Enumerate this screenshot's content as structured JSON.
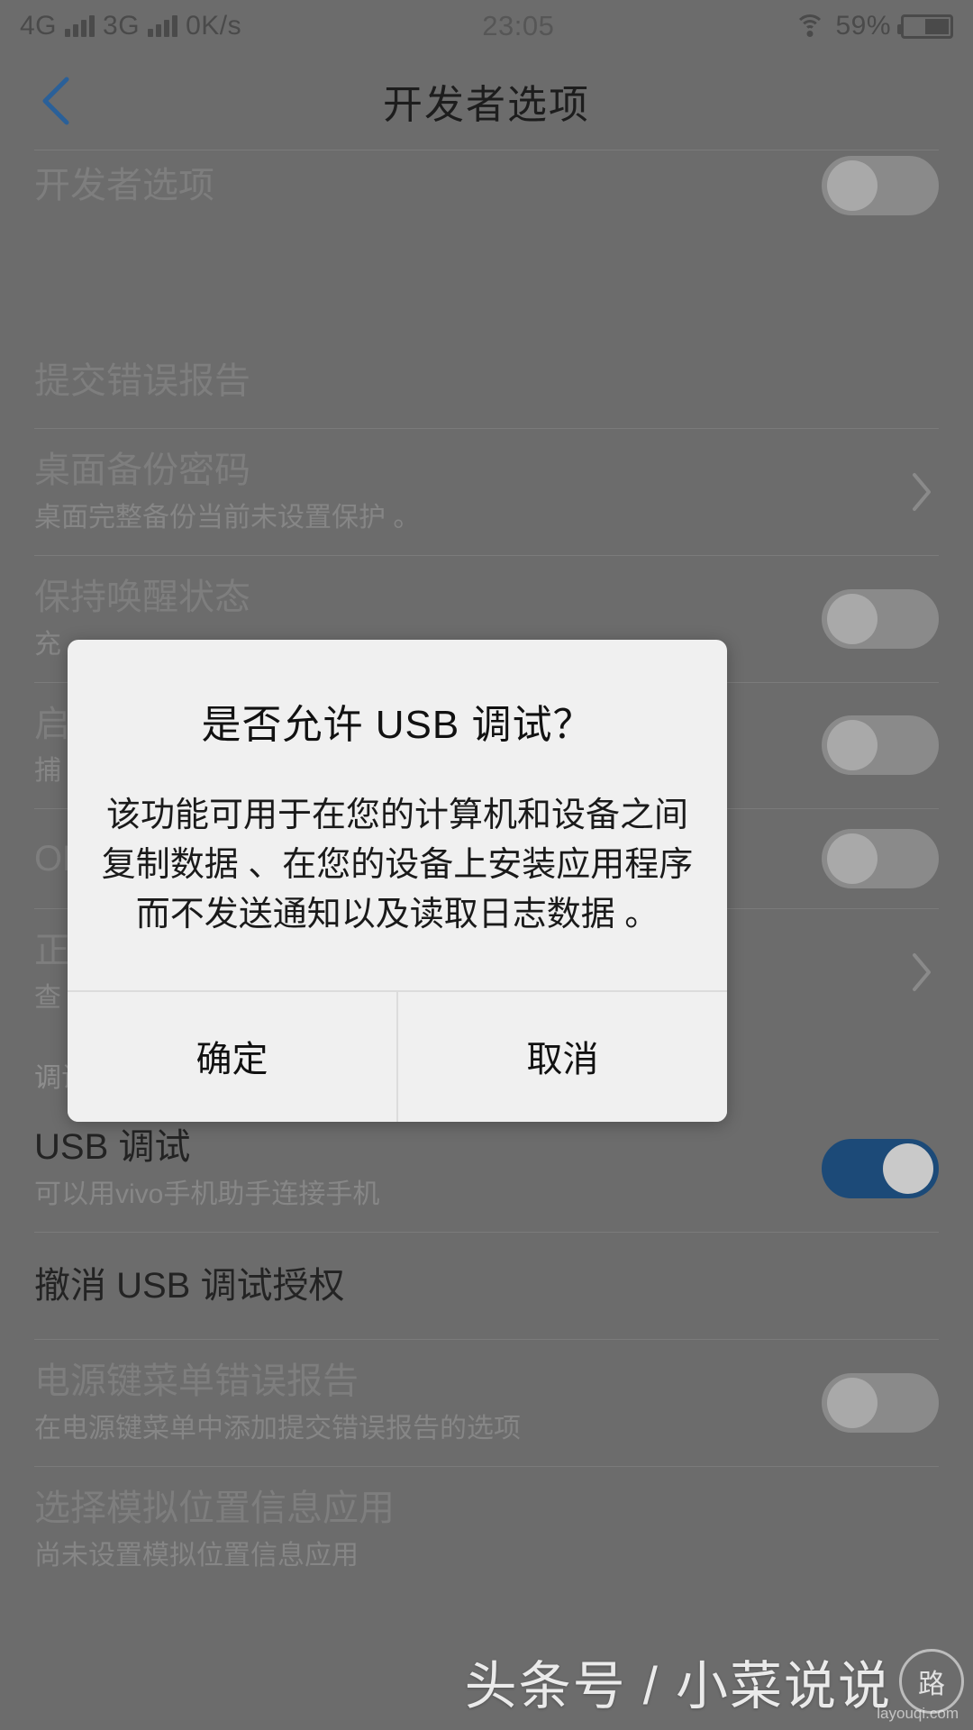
{
  "status_bar": {
    "network_4g": "4G",
    "network_3g": "3G",
    "data_rate": "0K/s",
    "time": "23:05",
    "battery_percent": "59%",
    "wifi_icon": "wifi-icon",
    "battery_icon": "battery-icon"
  },
  "header": {
    "back_icon": "back-chevron-icon",
    "title": "开发者选项",
    "accent_color": "#2a6099"
  },
  "list": {
    "rows": [
      {
        "title": "开发者选项",
        "subtitle": "",
        "control": "toggle-off"
      },
      {
        "title": "提交错误报告",
        "subtitle": "",
        "control": "none"
      },
      {
        "title": "桌面备份密码",
        "subtitle": "桌面完整备份当前未设置保护 。",
        "control": "chevron"
      },
      {
        "title": "保持唤醒状态",
        "subtitle": "充",
        "control": "toggle-off"
      },
      {
        "title": "启",
        "subtitle": "捕",
        "control": "toggle-off"
      },
      {
        "title": "OE",
        "subtitle": "",
        "control": "toggle-off"
      },
      {
        "title": "正",
        "subtitle": "查",
        "control": "chevron"
      }
    ],
    "debug_section_header": "调试",
    "debug_rows": [
      {
        "title": "USB 调试",
        "subtitle": "可以用vivo手机助手连接手机",
        "control": "toggle-on"
      },
      {
        "title": "撤消 USB 调试授权",
        "subtitle": "",
        "control": "none"
      },
      {
        "title": "电源键菜单错误报告",
        "subtitle": "在电源键菜单中添加提交错误报告的选项",
        "control": "toggle-off"
      },
      {
        "title": "选择模拟位置信息应用",
        "subtitle": "尚未设置模拟位置信息应用",
        "control": "none"
      }
    ],
    "toggle_on_color": "#1c4a78"
  },
  "dialog": {
    "title": "是否允许 USB 调试？",
    "message": "该功能可用于在您的计算机和设备之间复制数据 、在您的设备上安装应用程序而不发送通知以及读取日志数据 。",
    "confirm_label": "确定",
    "cancel_label": "取消"
  },
  "watermark": {
    "text": "头条号 / 小菜说说",
    "badge": "路",
    "sub": "layouqi.com"
  }
}
